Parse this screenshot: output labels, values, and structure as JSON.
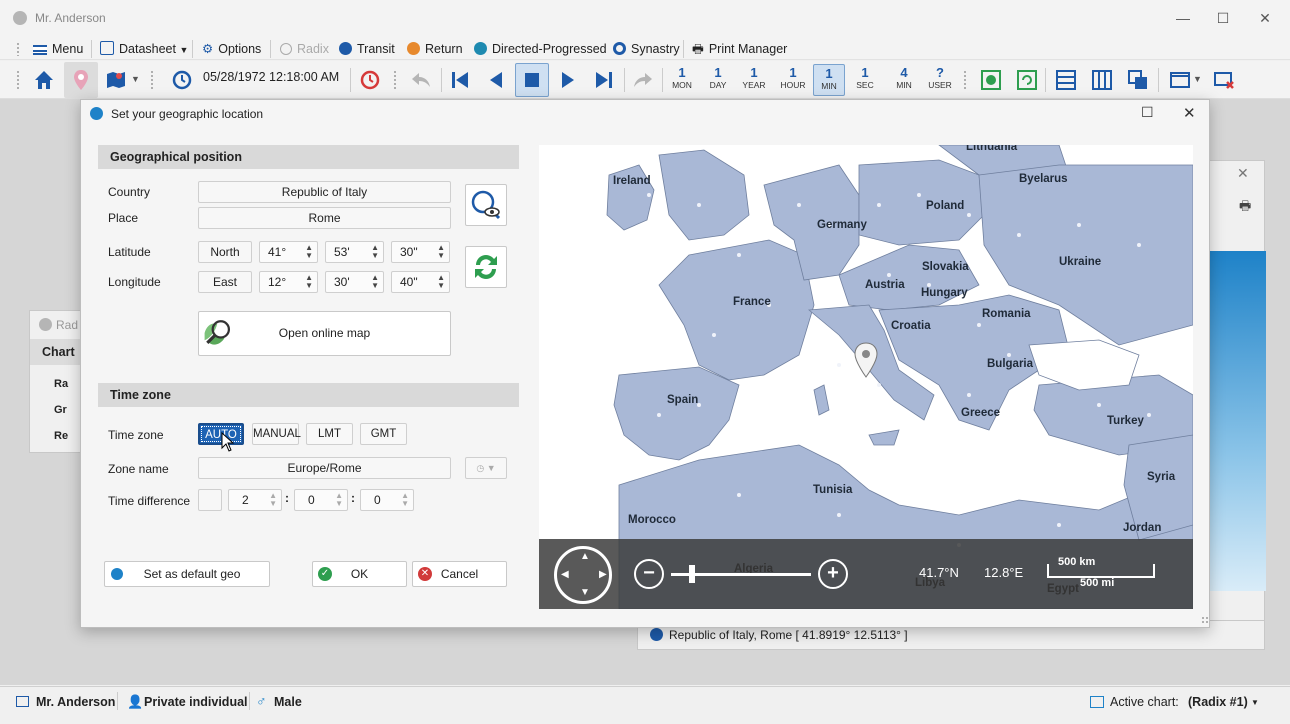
{
  "window": {
    "title": "Mr. Anderson"
  },
  "menu": {
    "menu": "Menu",
    "datasheet": "Datasheet",
    "options": "Options",
    "radix": "Radix",
    "transit": "Transit",
    "return": "Return",
    "directed": "Directed-Progressed",
    "synastry": "Synastry",
    "print_manager": "Print Manager"
  },
  "toolbar": {
    "datetime": "05/28/1972 12:18:00 AM",
    "steps": [
      {
        "n": "1",
        "l": "MON"
      },
      {
        "n": "1",
        "l": "DAY"
      },
      {
        "n": "1",
        "l": "YEAR"
      },
      {
        "n": "1",
        "l": "HOUR"
      },
      {
        "n": "1",
        "l": "MIN"
      },
      {
        "n": "1",
        "l": "SEC"
      },
      {
        "n": "4",
        "l": "MIN"
      },
      {
        "n": "?",
        "l": "USER"
      }
    ]
  },
  "background": {
    "panel_title": "Rad",
    "panel_tab": "Chart",
    "item1": "Ra",
    "item2": "Gr",
    "item3": "Re",
    "location_line": "Republic of Italy, Rome  [ 41.8919°  12.5113° ]"
  },
  "dialog": {
    "title": "Set your geographic location",
    "geo_section": "Geographical position",
    "country_label": "Country",
    "country_value": "Republic of Italy",
    "place_label": "Place",
    "place_value": "Rome",
    "latitude_label": "Latitude",
    "lat_dir": "North",
    "lat_deg": "41°",
    "lat_min": "53'",
    "lat_sec": "30\"",
    "longitude_label": "Longitude",
    "lon_dir": "East",
    "lon_deg": "12°",
    "lon_min": "30'",
    "lon_sec": "40\"",
    "open_map": "Open online map",
    "tz_section": "Time zone",
    "tz_label": "Time zone",
    "tz_auto": "AUTO",
    "tz_manual": "MANUAL",
    "tz_lmt": "LMT",
    "tz_gmt": "GMT",
    "zone_name_label": "Zone name",
    "zone_name_value": "Europe/Rome",
    "time_diff_label": "Time difference",
    "td_h": "2",
    "td_m": "0",
    "td_s": "0",
    "set_default": "Set as default geo",
    "ok": "OK",
    "cancel": "Cancel"
  },
  "map": {
    "countries": [
      "Lithuania",
      "Ireland",
      "Byelarus",
      "Poland",
      "Germany",
      "Ukraine",
      "Slovakia",
      "Austria",
      "Hungary",
      "France",
      "Romania",
      "Croatia",
      "Bulgaria",
      "Spain",
      "Greece",
      "Turkey",
      "Syria",
      "Tunisia",
      "Morocco",
      "Jordan",
      "Algeria",
      "Libya",
      "Egypt"
    ],
    "lat": "41.7°N",
    "lon": "12.8°E",
    "scale_km": "500 km",
    "scale_mi": "500 mi"
  },
  "statusbar": {
    "person": "Mr. Anderson",
    "type": "Private individual",
    "gender": "Male",
    "active_label": "Active chart:",
    "active_value": "(Radix #1)"
  },
  "colors": {
    "accent": "#1e63b4",
    "land": "#a9b8d6",
    "border": "#5e6f8f",
    "ok_green": "#2e9e4f",
    "cancel_red": "#d13a3a"
  }
}
